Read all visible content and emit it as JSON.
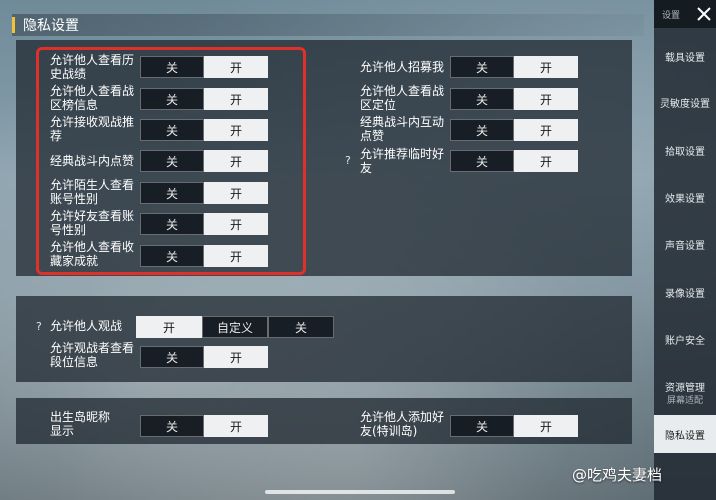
{
  "header": {
    "title": "隐私设置"
  },
  "toggle_labels": {
    "off": "关",
    "on": "开",
    "custom": "自定义"
  },
  "panel1": {
    "left_rows": [
      {
        "label": "允许他人查看历史战绩",
        "selected": "on"
      },
      {
        "label": "允许他人查看战区榜信息",
        "selected": "on"
      },
      {
        "label": "允许接收观战推荐",
        "selected": "on"
      },
      {
        "label": "经典战斗内点赞",
        "selected": "on"
      },
      {
        "label": "允许陌生人查看账号性别",
        "selected": "on"
      },
      {
        "label": "允许好友查看账号性别",
        "selected": "on"
      },
      {
        "label": "允许他人查看收藏家成就",
        "selected": "on"
      }
    ],
    "right_rows": [
      {
        "label": "允许他人招募我",
        "selected": "on"
      },
      {
        "label": "允许他人查看战区定位",
        "selected": "on"
      },
      {
        "label": "经典战斗内互动点赞",
        "selected": "on"
      },
      {
        "label": "允许推荐临时好友",
        "selected": "on",
        "help": "?"
      }
    ]
  },
  "panel2": {
    "spectate": {
      "label": "允许他人观战",
      "help": "?",
      "selected": "on"
    },
    "spectator_rank": {
      "label": "允许观战者查看段位信息",
      "selected": "on"
    }
  },
  "panel3": {
    "left": {
      "label": "出生岛昵称显示",
      "selected": "on"
    },
    "right": {
      "label": "允许他人添加好友(特训岛)",
      "selected": "on"
    }
  },
  "sidebar": {
    "top_label": "设置",
    "items": [
      {
        "label": "载具设置"
      },
      {
        "label": "灵敏度设置"
      },
      {
        "label": "拾取设置"
      },
      {
        "label": "效果设置"
      },
      {
        "label": "声音设置"
      },
      {
        "label": "录像设置"
      },
      {
        "label": "账户安全"
      },
      {
        "label": "资源管理"
      },
      {
        "label": "隐私设置",
        "active": true
      }
    ],
    "footer": "屏幕适配"
  },
  "watermark": "@吃鸡夫妻档",
  "colors": {
    "highlight": "#e0302a",
    "accent": "#f2c230",
    "on_bg": "#eef0f1"
  }
}
